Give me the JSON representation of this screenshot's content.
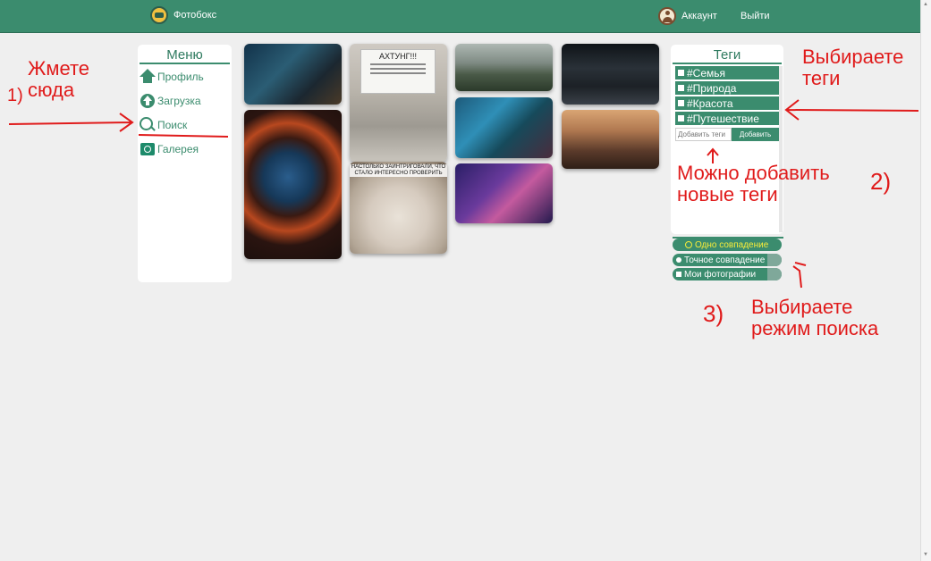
{
  "header": {
    "brand": "Фотобокс",
    "account": "Аккаунт",
    "logout": "Выйти"
  },
  "menu": {
    "title": "Меню",
    "items": [
      {
        "label": "Профиль",
        "icon": "home-icon"
      },
      {
        "label": "Загрузка",
        "icon": "upload-icon"
      },
      {
        "label": "Поиск",
        "icon": "search-icon"
      },
      {
        "label": "Галерея",
        "icon": "gallery-icon"
      }
    ]
  },
  "photos": {
    "sign_text": "АХТУНГ!!!",
    "meme_caption": "НАСТОЛЬКО ЗАИНТРИГОВАЛИ, ЧТО СТАЛО ИНТЕРЕСНО ПРОВЕРИТЬ"
  },
  "tags": {
    "title": "Теги",
    "items": [
      "#Семья",
      "#Природа",
      "#Красота",
      "#Путешествие"
    ],
    "input_placeholder": "Добавить теги",
    "add_button": "Добавить"
  },
  "search_modes": {
    "items": [
      "Одно совпадение",
      "Точное совпадение",
      "Мои фотографии"
    ],
    "selected": "Одно совпадение"
  },
  "annotations": {
    "step1_text": "Жмете\nсюда",
    "step1_num": "1)",
    "tags_text": "Выбираете\nтеги",
    "step2_text": "Можно добавить\nновые теги",
    "step2_num": "2)",
    "step3_num": "3)",
    "step3_text": "Выбираете\nрежим поиска"
  },
  "colors": {
    "accent": "#3b8c6e",
    "annotation": "#e01b1b",
    "selected_text": "#f6ec3a"
  }
}
